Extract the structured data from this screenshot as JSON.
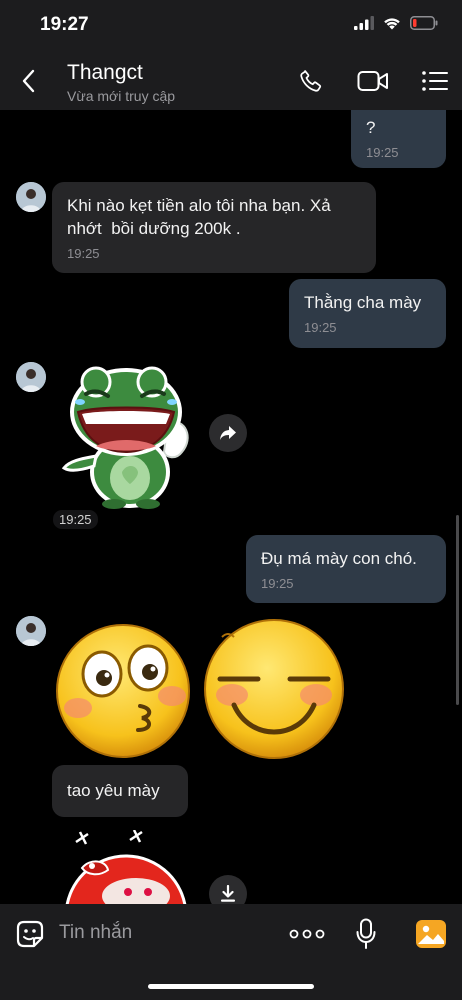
{
  "status_bar": {
    "time": "19:27"
  },
  "header": {
    "contact_name": "Thangct",
    "contact_status": "Vừa mới truy cập"
  },
  "messages": [
    {
      "id": "m0",
      "direction": "out",
      "text": "?",
      "time": "19:25"
    },
    {
      "id": "m1",
      "direction": "in",
      "text": "Khi nào kẹt tiền alo tôi nha bạn. Xả\nnhớt  bồi dưỡng 200k .",
      "time": "19:25"
    },
    {
      "id": "m2",
      "direction": "out",
      "text": "Thằng cha mày",
      "time": "19:25"
    },
    {
      "id": "m3",
      "direction": "in",
      "type": "sticker",
      "sticker": "laughing-frog-sticker",
      "time": "19:25"
    },
    {
      "id": "m4",
      "direction": "out",
      "text": "Đụ má mày con chó.",
      "time": "19:25"
    },
    {
      "id": "m5",
      "direction": "in",
      "type": "emoji",
      "emoji": [
        "kissing-face-emoji",
        "relieved-face-emoji"
      ]
    },
    {
      "id": "m6",
      "direction": "in",
      "text": "tao yêu mày"
    },
    {
      "id": "m7",
      "direction": "in",
      "type": "sticker",
      "sticker": "red-character-sticker"
    }
  ],
  "input_bar": {
    "placeholder": "Tin nhắn"
  },
  "colors": {
    "background": "#000000",
    "bar": "#1c1c1e",
    "incoming_bubble": "#262628",
    "outgoing_bubble": "#2f3a47",
    "timestamp": "#8e8e93",
    "accent_image_button": "#f5a623",
    "battery_low": "#ff3b30"
  },
  "icons": {
    "back": "chevron-left-icon",
    "call": "phone-icon",
    "video": "video-camera-icon",
    "menu": "list-menu-icon",
    "share": "share-forward-icon",
    "download": "download-icon",
    "sticker": "sticker-smile-icon",
    "more": "more-dots-icon",
    "mic": "microphone-icon",
    "image": "image-gallery-icon"
  }
}
